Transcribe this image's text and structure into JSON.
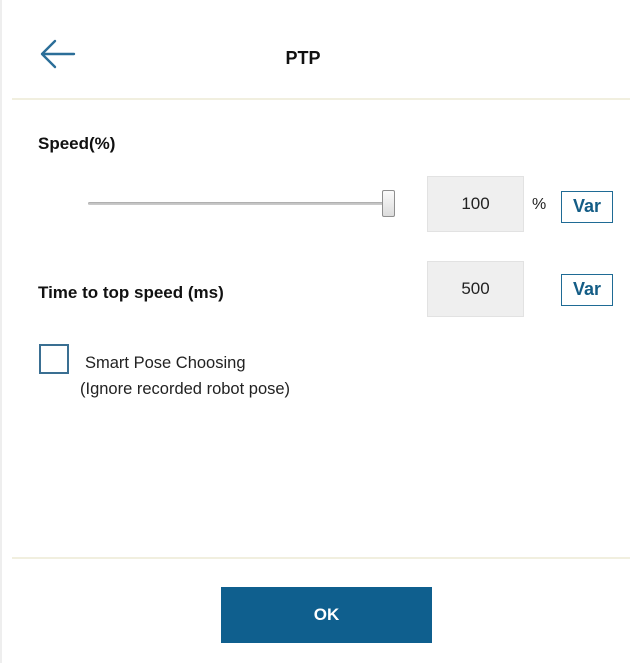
{
  "header": {
    "title": "PTP"
  },
  "speed": {
    "label": "Speed(%)",
    "value": "100",
    "unit": "%",
    "slider_fraction": 1.0,
    "var_label": "Var"
  },
  "time_to_top": {
    "label": "Time to top speed (ms)",
    "value": "500",
    "var_label": "Var"
  },
  "smart_pose": {
    "label": "Smart Pose Choosing",
    "sublabel": "(Ignore recorded robot pose)",
    "checked": false
  },
  "footer": {
    "ok_label": "OK"
  },
  "colors": {
    "accent": "#0f5f8e",
    "var_border": "#1f6b95",
    "divider": "#f1efdf",
    "input_bg": "#efefef"
  },
  "icons": {
    "back": "arrow-left-icon"
  }
}
